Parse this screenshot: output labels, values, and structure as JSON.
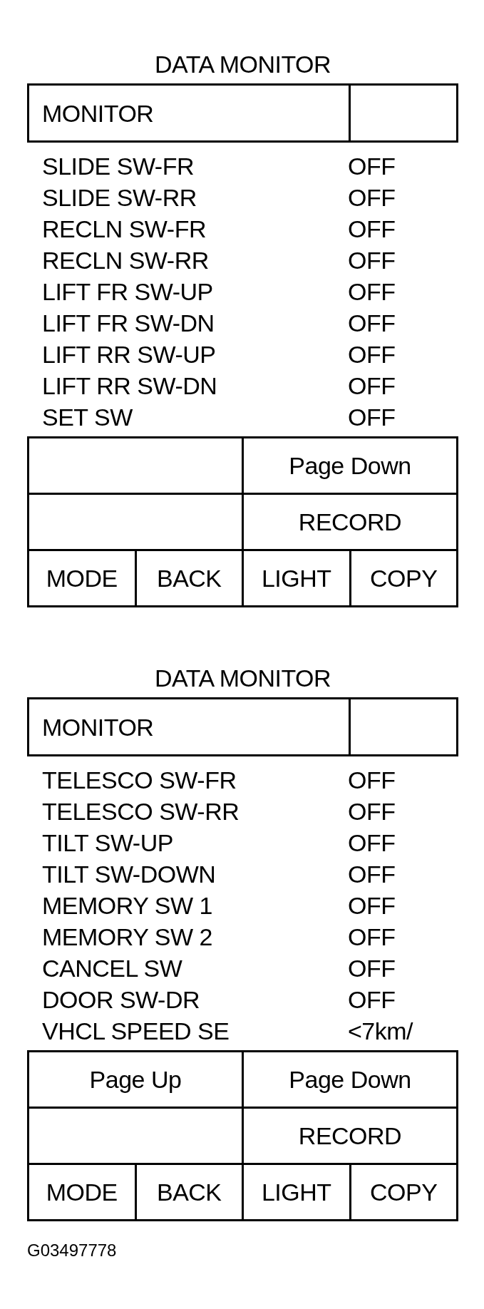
{
  "panels": [
    {
      "title": "DATA MONITOR",
      "header": "MONITOR",
      "items": [
        {
          "label": "SLIDE SW-FR",
          "value": "OFF"
        },
        {
          "label": "SLIDE SW-RR",
          "value": "OFF"
        },
        {
          "label": "RECLN SW-FR",
          "value": "OFF"
        },
        {
          "label": "RECLN SW-RR",
          "value": "OFF"
        },
        {
          "label": "LIFT FR SW-UP",
          "value": "OFF"
        },
        {
          "label": "LIFT FR SW-DN",
          "value": "OFF"
        },
        {
          "label": "LIFT RR SW-UP",
          "value": "OFF"
        },
        {
          "label": "LIFT RR SW-DN",
          "value": "OFF"
        },
        {
          "label": "SET SW",
          "value": "OFF"
        }
      ],
      "keys": {
        "wide_rows": [
          {
            "right": "Page Down"
          },
          {
            "right": "RECORD"
          }
        ],
        "bottom_row": [
          "MODE",
          "BACK",
          "LIGHT",
          "COPY"
        ]
      }
    },
    {
      "title": "DATA MONITOR",
      "header": "MONITOR",
      "items": [
        {
          "label": "TELESCO SW-FR",
          "value": "OFF"
        },
        {
          "label": "TELESCO SW-RR",
          "value": "OFF"
        },
        {
          "label": "TILT SW-UP",
          "value": "OFF"
        },
        {
          "label": "TILT SW-DOWN",
          "value": "OFF"
        },
        {
          "label": "MEMORY SW 1",
          "value": "OFF"
        },
        {
          "label": "MEMORY SW 2",
          "value": "OFF"
        },
        {
          "label": "CANCEL SW",
          "value": "OFF"
        },
        {
          "label": "DOOR SW-DR",
          "value": "OFF"
        },
        {
          "label": "VHCL SPEED SE",
          "value": "<7km/"
        }
      ],
      "keys": {
        "wide_rows": [
          {
            "left": "Page Up",
            "right": "Page Down"
          },
          {
            "right": "RECORD"
          }
        ],
        "bottom_row": [
          "MODE",
          "BACK",
          "LIGHT",
          "COPY"
        ]
      }
    }
  ],
  "figure_code": "G03497778"
}
